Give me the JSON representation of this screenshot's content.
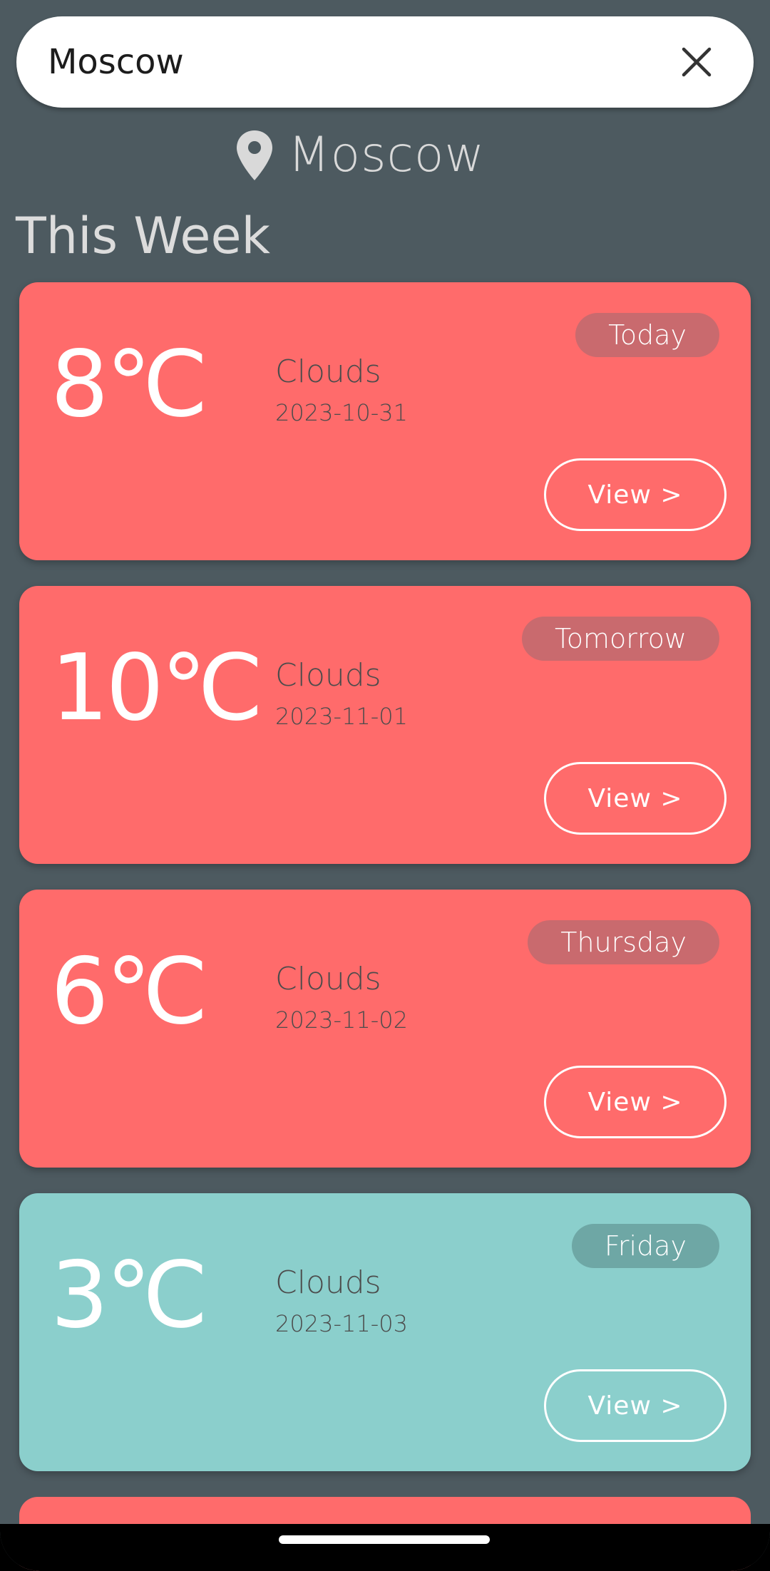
{
  "search": {
    "value": "Moscow",
    "clear_icon": "close-icon"
  },
  "location": {
    "icon": "map-pin-icon",
    "name": "Moscow"
  },
  "section_title": "This Week",
  "forecast": [
    {
      "temp": "8℃",
      "condition": "Clouds",
      "date": "2023-10-31",
      "day": "Today",
      "view_label": "View >",
      "color": "#ff6b6b"
    },
    {
      "temp": "10℃",
      "condition": "Clouds",
      "date": "2023-11-01",
      "day": "Tomorrow",
      "view_label": "View >",
      "color": "#ff6b6b"
    },
    {
      "temp": "6℃",
      "condition": "Clouds",
      "date": "2023-11-02",
      "day": "Thursday",
      "view_label": "View >",
      "color": "#ff6b6b"
    },
    {
      "temp": "3℃",
      "condition": "Clouds",
      "date": "2023-11-03",
      "day": "Friday",
      "view_label": "View >",
      "color": "#8bcfcc"
    }
  ],
  "colors": {
    "background": "#4d5a60",
    "warm_card": "#ff6b6b",
    "cool_card": "#8bcfcc"
  }
}
